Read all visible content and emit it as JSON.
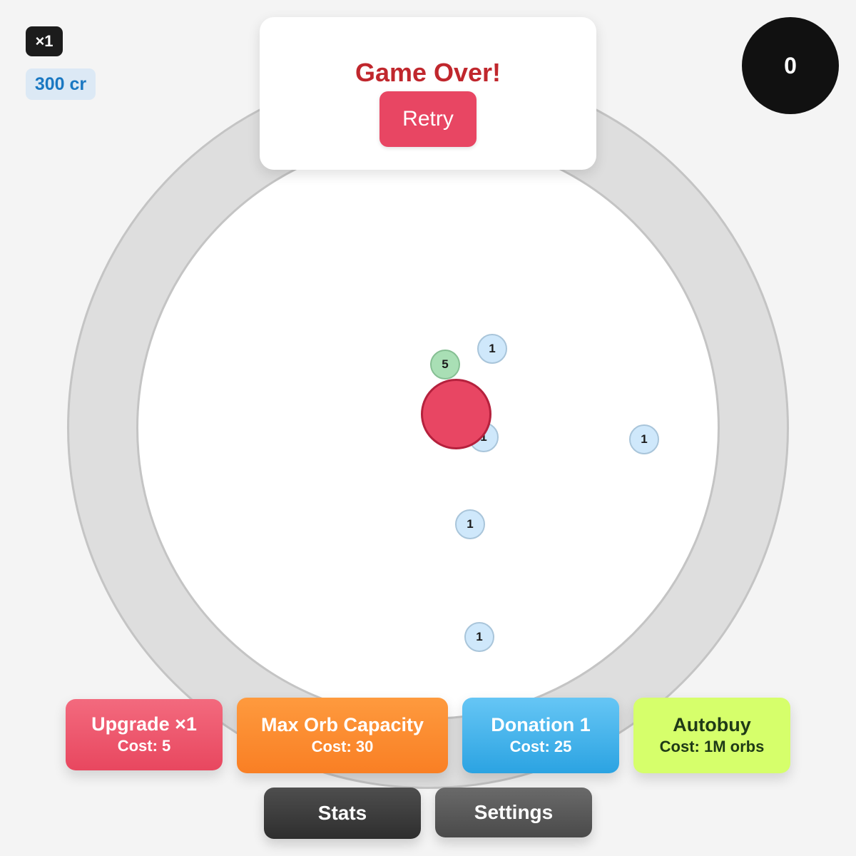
{
  "hud": {
    "multiplier": "×1",
    "credits": "300 cr",
    "score": "0"
  },
  "game_over": {
    "title": "Game Over!",
    "retry_label": "Retry"
  },
  "orbs": [
    {
      "value": "5",
      "color": "green"
    },
    {
      "value": "1",
      "color": "blue"
    },
    {
      "value": "1",
      "color": "blue"
    },
    {
      "value": "1",
      "color": "blue"
    },
    {
      "value": "1",
      "color": "blue"
    },
    {
      "value": "1",
      "color": "blue"
    }
  ],
  "shop": {
    "upgrade": {
      "title": "Upgrade ×1",
      "cost": "Cost: 5"
    },
    "capacity": {
      "title": "Max Orb Capacity",
      "cost": "Cost: 30"
    },
    "donation": {
      "title": "Donation 1",
      "cost": "Cost: 25"
    },
    "autobuy": {
      "title": "Autobuy",
      "cost": "Cost: 1M orbs"
    }
  },
  "nav": {
    "stats": "Stats",
    "settings": "Settings"
  },
  "colors": {
    "player": "#e84663",
    "game_over_title": "#c0272d",
    "upgrade": "#e8475f",
    "capacity": "#f97f24",
    "donation": "#2ba3e2",
    "autobuy": "#d6ff6b"
  }
}
